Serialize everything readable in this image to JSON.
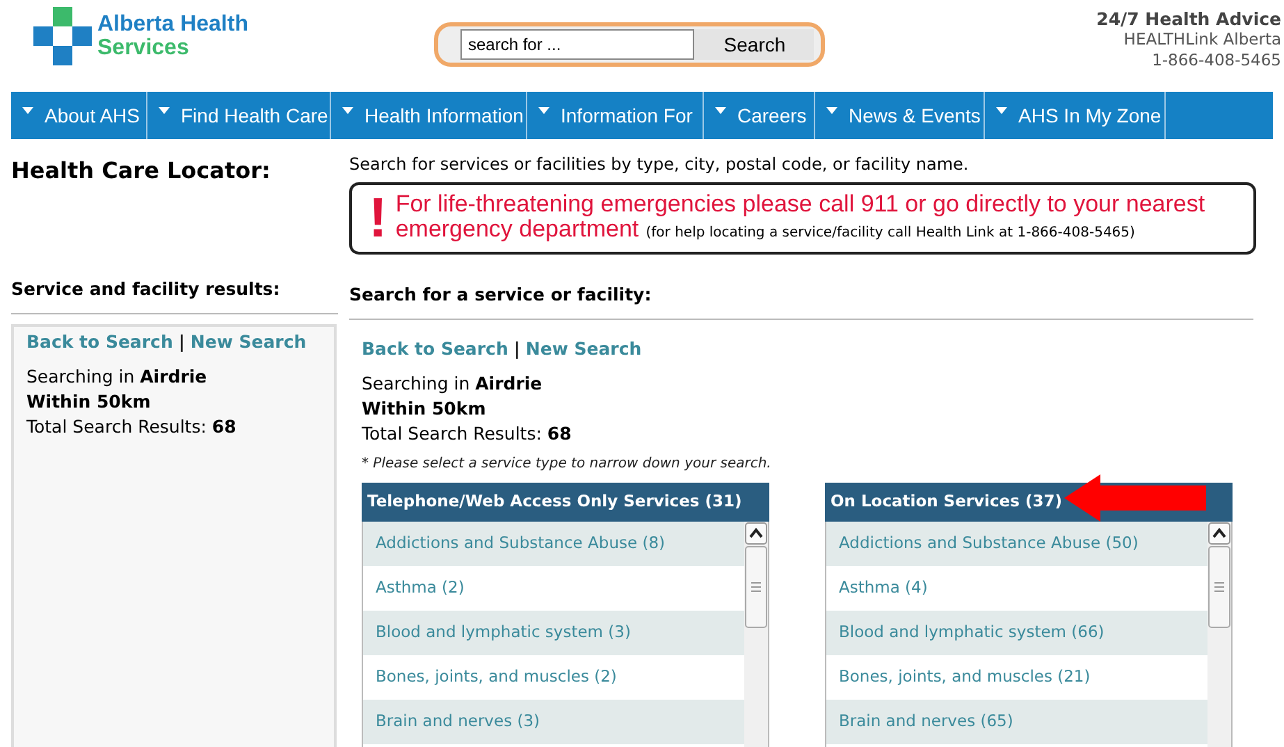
{
  "logo": {
    "line1": "Alberta Health",
    "line2": "Services"
  },
  "search": {
    "placeholder": "search for ...",
    "button": "Search"
  },
  "health_advice": {
    "title": "24/7 Health Advice",
    "line1": "HEALTHLink Alberta",
    "line2": "1-866-408-5465"
  },
  "nav": [
    {
      "label": "About AHS"
    },
    {
      "label": "Find Health Care"
    },
    {
      "label": "Health Information"
    },
    {
      "label": "Information For"
    },
    {
      "label": "Careers"
    },
    {
      "label": "News & Events"
    },
    {
      "label": "AHS In My Zone"
    }
  ],
  "page_title": "Health Care Locator:",
  "intro": "Search for services or facilities by type, city, postal code, or facility name.",
  "emergency": {
    "mark": "!",
    "message": "For life-threatening emergencies please call 911 or go directly to your nearest emergency department",
    "note": "(for help locating a service/facility call Health Link at 1-866-408-5465)"
  },
  "results_panel": {
    "heading": "Service and facility results:",
    "links": [
      "Back to Search",
      "New Search"
    ],
    "separator": "|",
    "summary": [
      "Searching in **Airdrie**",
      "**Within 50km**",
      "Total Search Results: **68**"
    ]
  },
  "search_panel": {
    "heading": "Search for a service or facility:",
    "links": [
      "Back to Search",
      "New Search"
    ],
    "separator": "|",
    "summary": [
      "Searching in **Airdrie**",
      "**Within 50km**",
      "Total Search Results: **68**"
    ],
    "hint": "* Please select a service type to narrow down your search.",
    "lists": [
      {
        "title": "Telephone/Web Access Only Services (31)",
        "pointed": false,
        "items": [
          "Addictions and Substance Abuse (8)",
          "Asthma (2)",
          "Blood and lymphatic system (3)",
          "Bones, joints, and muscles (2)",
          "Brain and nerves (3)"
        ]
      },
      {
        "title": "On Location Services (37)",
        "pointed": true,
        "items": [
          "Addictions and Substance Abuse (50)",
          "Asthma (4)",
          "Blood and lymphatic system (66)",
          "Bones, joints, and muscles (21)",
          "Brain and nerves (65)"
        ]
      }
    ]
  }
}
